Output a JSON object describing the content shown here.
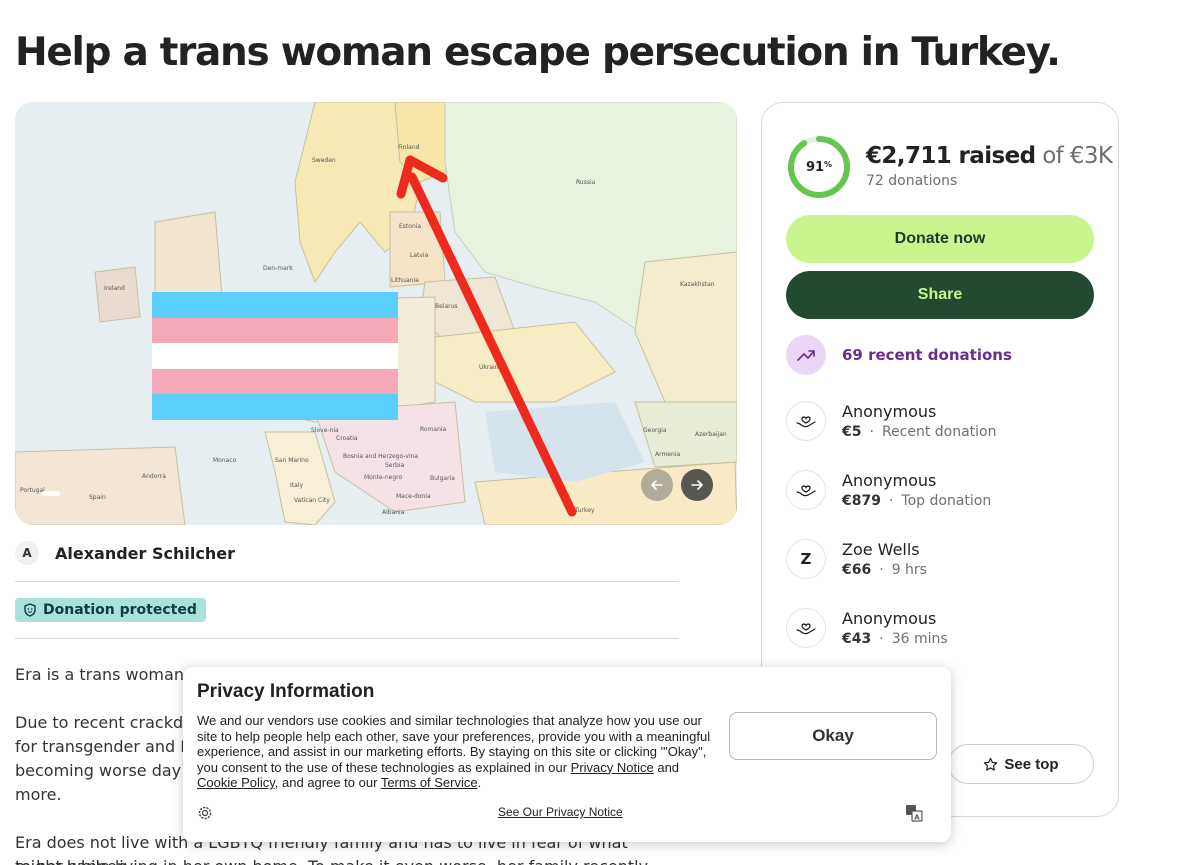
{
  "page": {
    "title": "Help a trans woman escape persecution in Turkey."
  },
  "media": {
    "map_labels": [
      "Sweden",
      "Finland",
      "Russia",
      "Estonia",
      "Latvia",
      "Lithuania",
      "Belarus",
      "Den-mark",
      "Ireland",
      "Ukraine",
      "Kazakhstan",
      "Romania",
      "Slove-nia",
      "Croatia",
      "Bosnia and Herzego-vina",
      "Serbia",
      "Monte-negro",
      "Bulgaria",
      "Mace-donia",
      "Albania",
      "Italy",
      "San Marino",
      "Vatican City",
      "Monaco",
      "Andorra",
      "Spain",
      "Portugal",
      "Georgia",
      "Azerbaijan",
      "Armenia",
      "Turkey"
    ],
    "prev_icon": "arrow-left-icon",
    "next_icon": "arrow-right-icon",
    "flag_colors": [
      "#5bcefa",
      "#f5a9b8",
      "#ffffff"
    ]
  },
  "organizer": {
    "initial": "A",
    "name": "Alexander Schilcher"
  },
  "badge": {
    "label": "Donation protected"
  },
  "story": {
    "p1": "Era is a trans woman livi",
    "p2_lines": [
      "Due to recent crackdow",
      "for transgender and LG",
      "becoming worse day b",
      "more."
    ],
    "p3_lines": [
      "Era does not live with a LGBTQ friendly family and has to live in fear of what might happen",
      "to her while living in her own home. To make it even worse, her family recently discovered"
    ]
  },
  "progress": {
    "percent": 91,
    "percent_sign": "%",
    "raised": "€2,711 raised",
    "goal": "of €3K",
    "count": "72 donations"
  },
  "actions": {
    "donate": "Donate now",
    "share": "Share"
  },
  "recent": {
    "label": "69 recent donations"
  },
  "donors": [
    {
      "name": "Anonymous",
      "amount": "€5",
      "note": "Recent donation",
      "avatar": "heart-hand-icon"
    },
    {
      "name": "Anonymous",
      "amount": "€879",
      "note": "Top donation",
      "avatar": "heart-hand-icon"
    },
    {
      "name": "Zoe Wells",
      "amount": "€66",
      "note": "9 hrs",
      "initial": "Z"
    },
    {
      "name": "Anonymous",
      "amount": "€43",
      "note": "36 mins",
      "avatar": "heart-hand-icon"
    }
  ],
  "see_top": {
    "label": "See top"
  },
  "privacy": {
    "title": "Privacy Information",
    "body_1": "We and our vendors use cookies and similar technologies that analyze how you use our site to help people help each other, save your preferences, provide you with a meaningful experience, and assist in our marketing efforts. By staying on this site or clicking '\"Okay\", you consent to the use of these technologies as explained in our ",
    "link_notice": "Privacy Notice",
    "body_2": " and ",
    "link_cookie": "Cookie Policy",
    "body_3": ", and agree to our ",
    "link_terms": "Terms of Service",
    "body_4": ".",
    "okay": "Okay",
    "footer_link": "See Our Privacy Notice"
  },
  "colors": {
    "accent_green": "#cbf48f",
    "dark_green": "#234a30",
    "purple": "#6b2c91",
    "ring_green": "#63c64f"
  }
}
